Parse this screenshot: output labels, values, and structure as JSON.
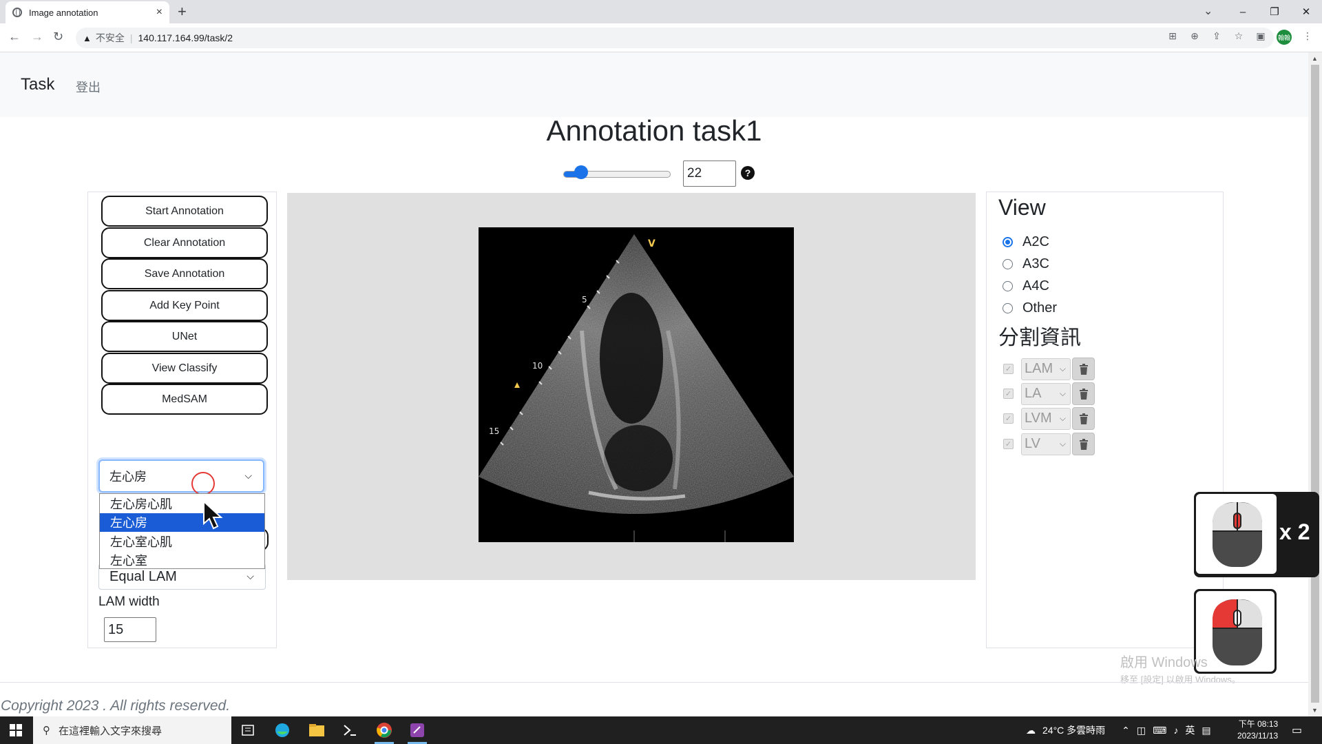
{
  "browser": {
    "tab_title": "Image annotation",
    "tab_close": "×",
    "new_tab": "+",
    "security_label": "不安全",
    "url": "140.117.164.99/task/2",
    "avatar_text": "翰翰"
  },
  "navbar": {
    "brand": "Task",
    "logout": "登出"
  },
  "page": {
    "title": "Annotation task1",
    "frame_value": "22",
    "frame_slider_fraction": 0.1,
    "help_symbol": "?"
  },
  "tools": {
    "buttons": [
      "Start Annotation",
      "Clear Annotation",
      "Save Annotation",
      "Add Key Point",
      "UNet",
      "View Classify",
      "MedSAM"
    ],
    "label_select_value": "左心房",
    "label_options": [
      {
        "label": "左心房心肌",
        "selected": false
      },
      {
        "label": "左心房",
        "selected": true
      },
      {
        "label": "左心室心肌",
        "selected": false
      },
      {
        "label": "左心室",
        "selected": false
      }
    ],
    "lam_select_value": "Equal LAM",
    "lam_width_label": "LAM width",
    "lam_width_value": "15"
  },
  "echo_image": {
    "depth_marks": [
      "5",
      "10",
      "15"
    ],
    "orientation_marker": "V"
  },
  "view_panel": {
    "title": "View",
    "options": [
      {
        "label": "A2C",
        "checked": true
      },
      {
        "label": "A3C",
        "checked": false
      },
      {
        "label": "A4C",
        "checked": false
      },
      {
        "label": "Other",
        "checked": false
      }
    ],
    "segmentation_title": "分割資訊",
    "segments": [
      "LAM",
      "LA",
      "LVM",
      "LV"
    ]
  },
  "mouse_overlay": {
    "double_click_label": "x 2"
  },
  "watermark": {
    "line1": "啟用 Windows",
    "line2": "移至 [設定] 以啟用 Windows。"
  },
  "footer": {
    "copyright": "Copyright 2023 . All rights reserved."
  },
  "taskbar": {
    "search_placeholder": "在這裡輸入文字來搜尋",
    "weather": "24°C 多雲時雨",
    "ime": "英",
    "time": "下午 08:13",
    "date": "2023/11/13"
  },
  "colors": {
    "accent": "#1a73e8",
    "dropdown_selected": "#1a5cd6",
    "click_marker": "#e53935"
  }
}
